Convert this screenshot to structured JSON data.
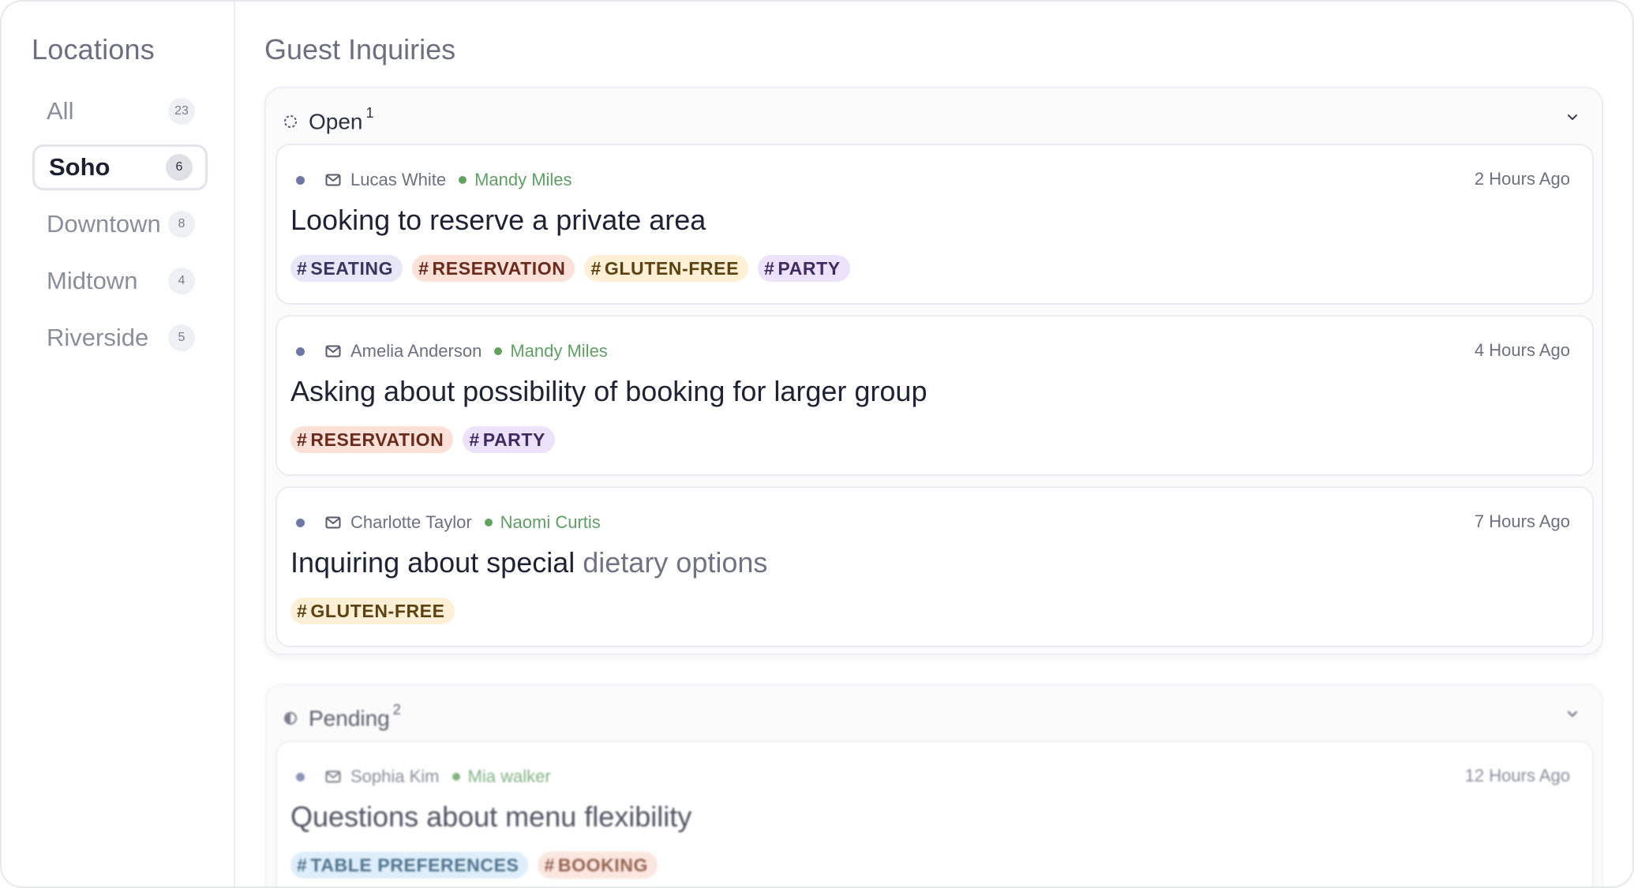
{
  "sidebar": {
    "title": "Locations",
    "items": [
      {
        "label": "All",
        "count": "23"
      },
      {
        "label": "Soho",
        "count": "6"
      },
      {
        "label": "Downtown",
        "count": "8"
      },
      {
        "label": "Midtown",
        "count": "4"
      },
      {
        "label": "Riverside",
        "count": "5"
      }
    ],
    "active": "Soho"
  },
  "main": {
    "title": "Guest Inquiries",
    "groups": [
      {
        "name": "Open",
        "count": "1",
        "status_icon": "dashed-circle-icon",
        "cards": [
          {
            "sender": "Lucas White",
            "assignee": "Mandy Miles",
            "time": "2 Hours Ago",
            "title": "Looking to reserve a private area",
            "tags": [
              {
                "label": "SEATING",
                "bg": "#e8e7f7",
                "fg": "#37365f"
              },
              {
                "label": "RESERVATION",
                "bg": "#fbe1d8",
                "fg": "#6a2a1c"
              },
              {
                "label": "GLUTEN-FREE",
                "bg": "#fdf0d6",
                "fg": "#5c4111"
              },
              {
                "label": "PARTY",
                "bg": "#ece2fb",
                "fg": "#3f2b62"
              }
            ]
          },
          {
            "sender": "Amelia Anderson",
            "assignee": "Mandy Miles",
            "time": "4 Hours Ago",
            "title": "Asking about possibility of booking for larger group",
            "tags": [
              {
                "label": "RESERVATION",
                "bg": "#fbe1d8",
                "fg": "#6a2a1c"
              },
              {
                "label": "PARTY",
                "bg": "#ece2fb",
                "fg": "#3f2b62"
              }
            ]
          },
          {
            "sender": "Charlotte Taylor",
            "assignee": "Naomi Curtis",
            "time": "7 Hours Ago",
            "title_main": "Inquiring about special ",
            "title_faded": "dietary options",
            "tags": [
              {
                "label": "GLUTEN-FREE",
                "bg": "#fdf0d6",
                "fg": "#5c4111"
              }
            ]
          }
        ]
      },
      {
        "name": "Pending",
        "count": "2",
        "status_icon": "half-circle-icon",
        "cards": [
          {
            "sender": "Sophia Kim",
            "assignee": "Mia walker",
            "time": "12 Hours Ago",
            "title": "Questions about menu flexibility",
            "tags": [
              {
                "label": "TABLE PREFERENCES",
                "bg": "#d6ebfa",
                "fg": "#1f4d6e"
              },
              {
                "label": "BOOKING",
                "bg": "#fbe1d8",
                "fg": "#7a3a24"
              }
            ]
          }
        ]
      }
    ]
  }
}
